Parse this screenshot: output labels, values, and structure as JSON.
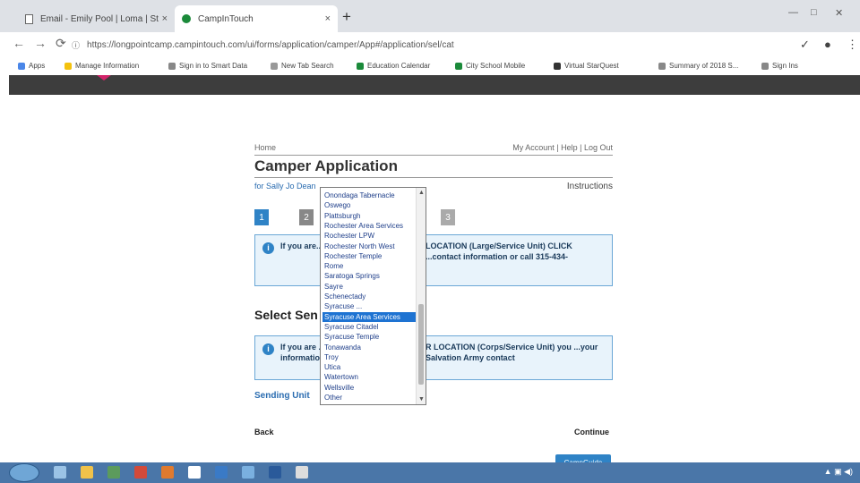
{
  "browser": {
    "tabs": [
      {
        "title": "Email - Emily Pool | Loma | Sto...",
        "favicon": "doc-icon",
        "active": false
      },
      {
        "title": "CampInTouch",
        "favicon": "green-circle-icon",
        "active": true
      }
    ],
    "new_tab_glyph": "+",
    "close_glyph": "×",
    "url": "https://longpointcamp.campintouch.com/ui/forms/application/camper/App#/application/sel/cat",
    "lock_glyph": "ⓘ",
    "nav": {
      "back": "←",
      "forward": "→",
      "reload": "⟳"
    },
    "window_controls": [
      "—",
      "□",
      "✕"
    ],
    "bookmarks": [
      {
        "label": "Apps",
        "color": "#4a86e8"
      },
      {
        "label": "Manage Information",
        "color": "#f4c20d"
      },
      {
        "label": "Sign in to Smart Data",
        "color": "#888888"
      },
      {
        "label": "New Tab Search",
        "color": "#999999"
      },
      {
        "label": "Education Calendar",
        "color": "#1b8a3a"
      },
      {
        "label": "City School Mobile",
        "color": "#1b8a3a"
      },
      {
        "label": "Virtual StarQuest",
        "color": "#333333"
      },
      {
        "label": "Summary of 2018 S...",
        "color": "#888888"
      },
      {
        "label": "Sign Ins",
        "color": "#888888"
      }
    ]
  },
  "page": {
    "home_link": "Home",
    "account_link": "My Account | Help | Log Out",
    "title": "Camper Application",
    "for_line": "for Sally Jo Dean",
    "instructions": "Instructions",
    "steps": [
      "1",
      "2",
      "3"
    ],
    "notice1_left": "If you are... HERE to ... 4332",
    "notice1_right": "LOCATION (Large/Service Unit) CLICK ...contact information or call 315-434-",
    "section_title": "Select Sen",
    "notice2_left": "If you are ... should se... information",
    "notice2_right": "R LOCATION (Corps/Service Unit) you ...your Salvation Army contact",
    "sending_unit": "Sending Unit",
    "back": "Back",
    "continue": "Continue",
    "small_button": "CampGuide"
  },
  "dropdown": {
    "selected_index": 12,
    "items": [
      "Onondaga Tabernacle",
      "Oswego",
      "Plattsburgh",
      "Rochester Area Services",
      "Rochester LPW",
      "Rochester North West",
      "Rochester Temple",
      "Rome",
      "Saratoga Springs",
      "Sayre",
      "Schenectady",
      "Syracuse ...",
      "Syracuse Area Services",
      "Syracuse Citadel",
      "Syracuse Temple",
      "Tonawanda",
      "Troy",
      "Utica",
      "Watertown",
      "Wellsville",
      "Other"
    ]
  },
  "colors": {
    "accent": "#2f83c6",
    "site_header": "#3d3d3d",
    "selected_item": "#1e73d2",
    "taskbar": "#4a76a8"
  }
}
